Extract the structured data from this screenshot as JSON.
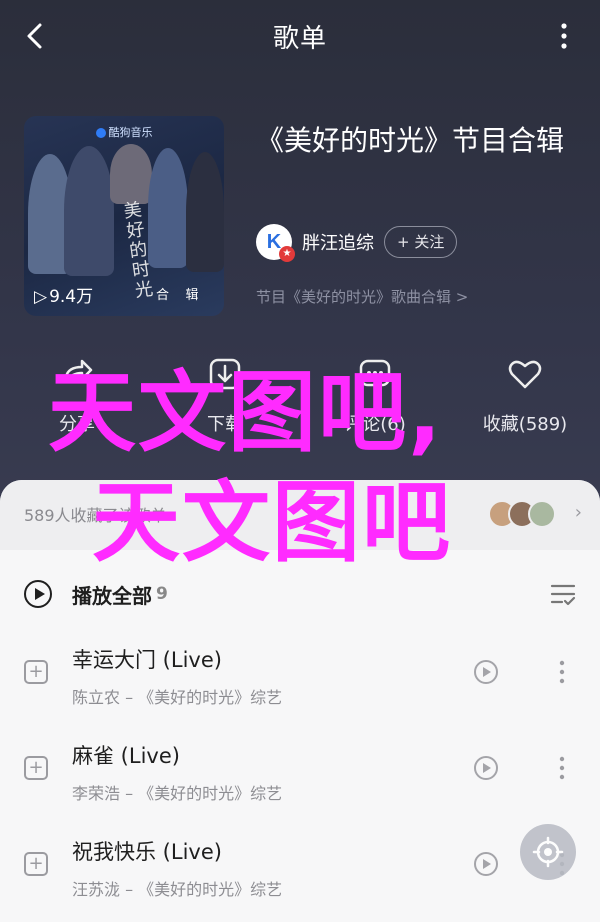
{
  "header": {
    "title": "歌单"
  },
  "album": {
    "cover_logo": "酷狗音乐",
    "cover_calligraphy": "美好的时光",
    "play_count": "9.4万",
    "cover_tag_1": "合",
    "cover_tag_2": "辑",
    "title": "《美好的时光》节目合辑",
    "author": "胖汪追综",
    "author_avatar_letter": "K",
    "follow_label": "+ 关注",
    "source": "节目《美好的时光》歌曲合辑 >"
  },
  "actions": [
    {
      "label": "分享",
      "icon": "share-icon"
    },
    {
      "label": "下载",
      "icon": "download-icon"
    },
    {
      "label": "评论(6)",
      "icon": "comment-icon"
    },
    {
      "label": "收藏(589)",
      "icon": "heart-icon"
    }
  ],
  "watermark": {
    "line1": "天文图吧,",
    "line2": "天文图吧"
  },
  "collect": {
    "text": "589人收藏了该歌单",
    "chevron": "›"
  },
  "list": {
    "play_all_label": "播放全部",
    "play_all_count": "9"
  },
  "songs": [
    {
      "title": "幸运大门 (Live)",
      "subtitle": "陈立农 – 《美好的时光》综艺"
    },
    {
      "title": "麻雀 (Live)",
      "subtitle": "李荣浩 – 《美好的时光》综艺"
    },
    {
      "title": "祝我快乐 (Live)",
      "subtitle": "汪苏泷 – 《美好的时光》综艺"
    }
  ],
  "colors": {
    "accent": "#ff2bff",
    "dark_bg": "#2e3140",
    "sheet_bg": "#f7f7f8"
  }
}
